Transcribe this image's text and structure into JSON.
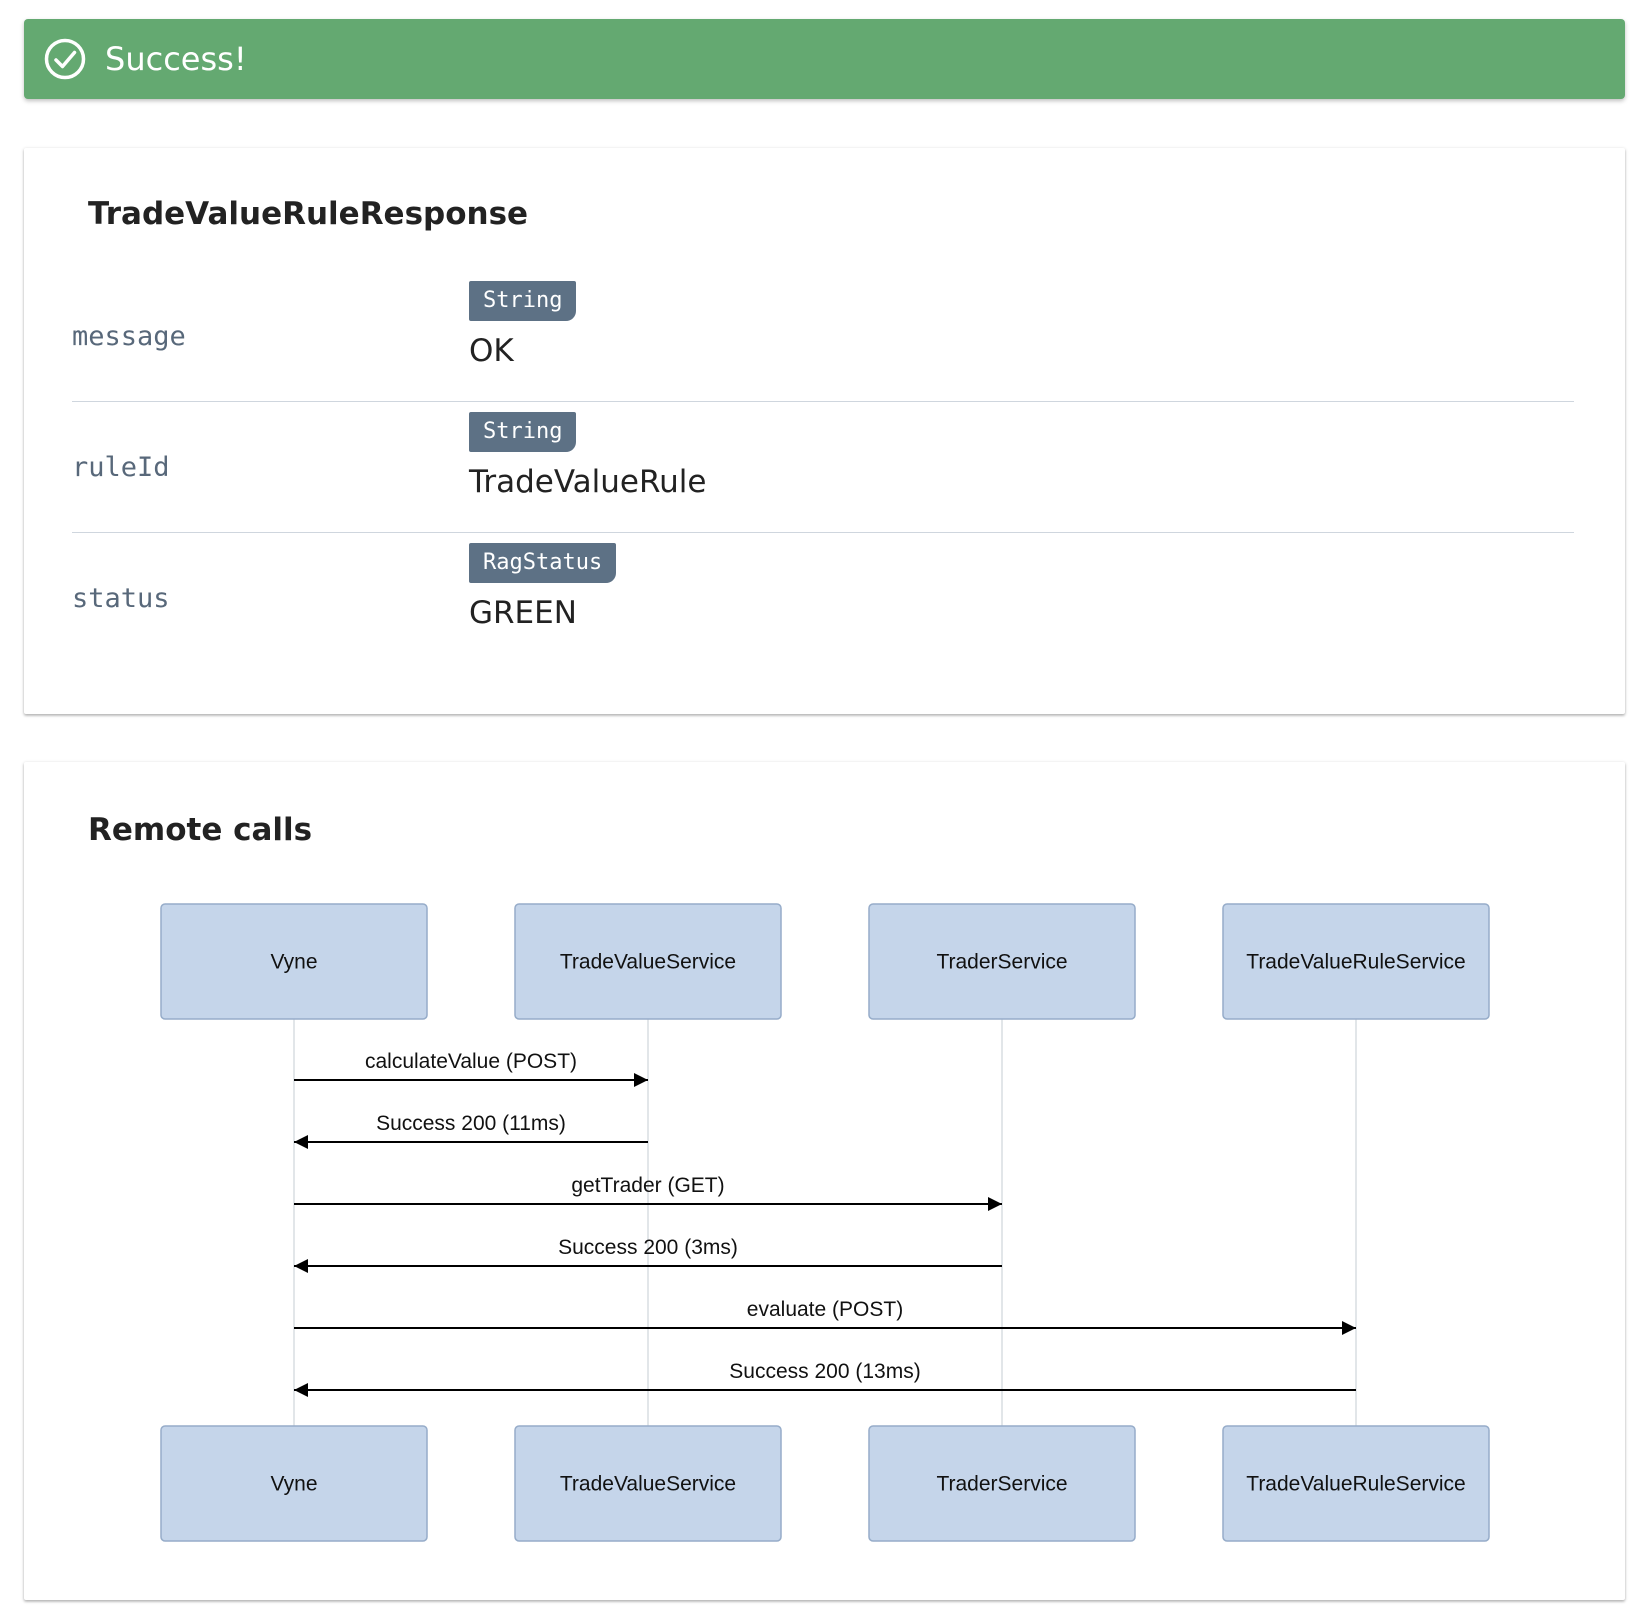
{
  "banner": {
    "icon": "check-circle-icon",
    "text": "Success!",
    "color": "#64a971"
  },
  "response": {
    "title": "TradeValueRuleResponse",
    "fields": [
      {
        "name": "message",
        "type": "String",
        "value": "OK"
      },
      {
        "name": "ruleId",
        "type": "String",
        "value": "TradeValueRule"
      },
      {
        "name": "status",
        "type": "RagStatus",
        "value": "GREEN"
      }
    ]
  },
  "remote_calls": {
    "title": "Remote calls",
    "participants": [
      "Vyne",
      "TradeValueService",
      "TraderService",
      "TradeValueRuleService"
    ],
    "messages": [
      {
        "from": "Vyne",
        "to": "TradeValueService",
        "label": "calculateValue (POST)"
      },
      {
        "from": "TradeValueService",
        "to": "Vyne",
        "label": "Success 200 (11ms)"
      },
      {
        "from": "Vyne",
        "to": "TraderService",
        "label": "getTrader (GET)"
      },
      {
        "from": "TraderService",
        "to": "Vyne",
        "label": "Success 200 (3ms)"
      },
      {
        "from": "Vyne",
        "to": "TradeValueRuleService",
        "label": "evaluate (POST)"
      },
      {
        "from": "TradeValueRuleService",
        "to": "Vyne",
        "label": "Success 200 (13ms)"
      }
    ],
    "colors": {
      "participant_fill": "#c5d5ea",
      "participant_border": "#96acc9",
      "lifeline": "#d9dde2",
      "arrow": "#000000"
    }
  }
}
